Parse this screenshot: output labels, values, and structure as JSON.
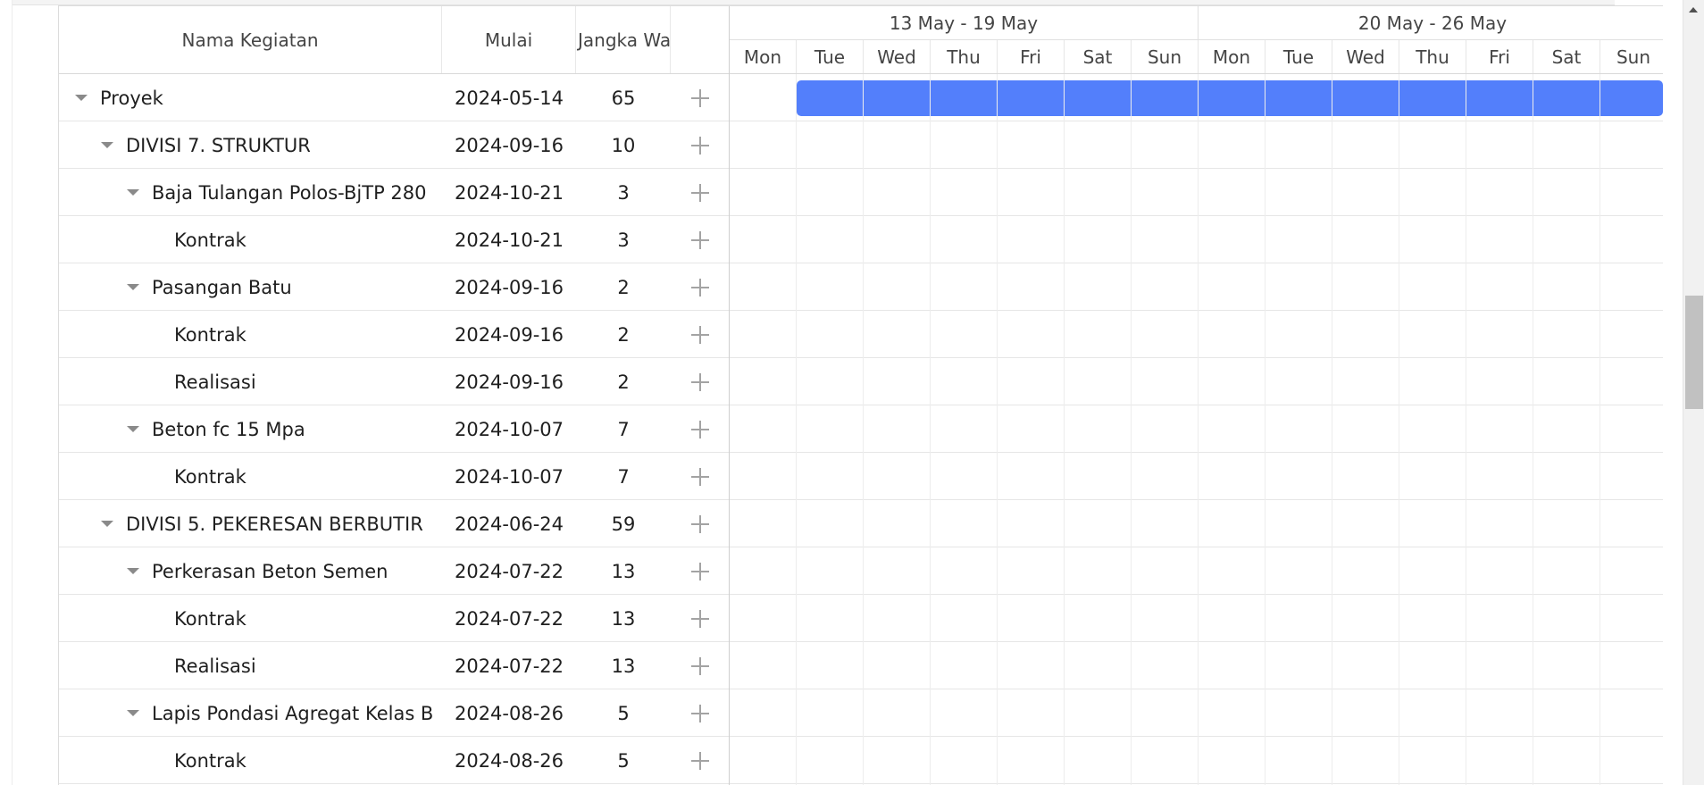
{
  "grid": {
    "columns": {
      "name": "Nama Kegiatan",
      "start": "Mulai",
      "duration": "Jangka Wa"
    },
    "rows": [
      {
        "name": "Proyek",
        "start": "2024-05-14",
        "duration": "65",
        "level": 0,
        "parent": true
      },
      {
        "name": "DIVISI 7. STRUKTUR",
        "start": "2024-09-16",
        "duration": "10",
        "level": 1,
        "parent": true
      },
      {
        "name": "Baja Tulangan Polos-BjTP 280",
        "start": "2024-10-21",
        "duration": "3",
        "level": 2,
        "parent": true
      },
      {
        "name": "Kontrak",
        "start": "2024-10-21",
        "duration": "3",
        "level": 3,
        "parent": false
      },
      {
        "name": "Pasangan Batu",
        "start": "2024-09-16",
        "duration": "2",
        "level": 2,
        "parent": true
      },
      {
        "name": "Kontrak",
        "start": "2024-09-16",
        "duration": "2",
        "level": 3,
        "parent": false
      },
      {
        "name": "Realisasi",
        "start": "2024-09-16",
        "duration": "2",
        "level": 3,
        "parent": false
      },
      {
        "name": "Beton fc 15 Mpa",
        "start": "2024-10-07",
        "duration": "7",
        "level": 2,
        "parent": true
      },
      {
        "name": "Kontrak",
        "start": "2024-10-07",
        "duration": "7",
        "level": 3,
        "parent": false
      },
      {
        "name": "DIVISI 5. PEKERESAN BERBUTIR",
        "start": "2024-06-24",
        "duration": "59",
        "level": 1,
        "parent": true
      },
      {
        "name": "Perkerasan Beton Semen",
        "start": "2024-07-22",
        "duration": "13",
        "level": 2,
        "parent": true
      },
      {
        "name": "Kontrak",
        "start": "2024-07-22",
        "duration": "13",
        "level": 3,
        "parent": false
      },
      {
        "name": "Realisasi",
        "start": "2024-07-22",
        "duration": "13",
        "level": 3,
        "parent": false
      },
      {
        "name": "Lapis Pondasi Agregat Kelas B",
        "start": "2024-08-26",
        "duration": "5",
        "level": 2,
        "parent": true
      },
      {
        "name": "Kontrak",
        "start": "2024-08-26",
        "duration": "5",
        "level": 3,
        "parent": false
      }
    ]
  },
  "timeline": {
    "weeks": [
      "13 May - 19 May",
      "20 May - 26 May"
    ],
    "days": [
      "Mon",
      "Tue",
      "Wed",
      "Thu",
      "Fri",
      "Sat",
      "Sun",
      "Mon",
      "Tue",
      "Wed",
      "Thu",
      "Fri",
      "Sat",
      "Sun"
    ],
    "bar_color": "#537ffb"
  }
}
